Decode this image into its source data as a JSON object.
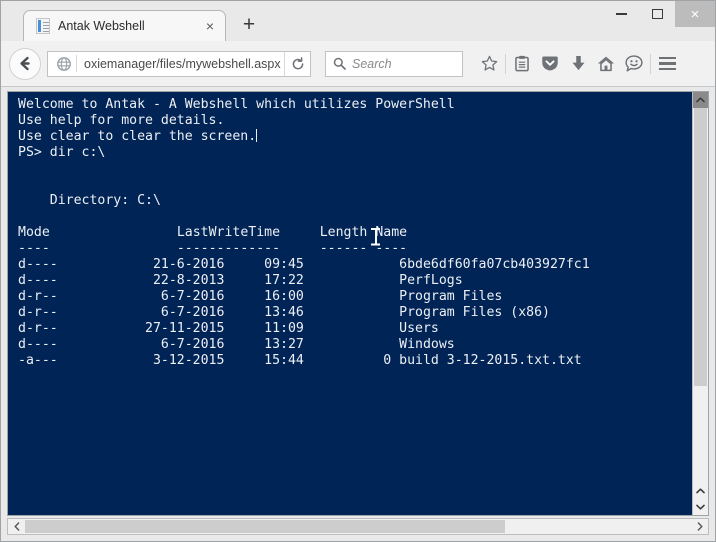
{
  "window": {
    "controls": {
      "minimize_label": "Minimize",
      "maximize_label": "Maximize",
      "close_label": "×"
    }
  },
  "tabs": [
    {
      "title": "Antak Webshell",
      "favicon": "document-icon",
      "close_label": "×",
      "active": true
    }
  ],
  "newtab": {
    "label": "+"
  },
  "navbar": {
    "back_label": "Back",
    "url_value": "oxiemanager/files/mywebshell.aspx",
    "reload_label": "Reload",
    "search_placeholder": "Search",
    "icons": [
      {
        "name": "bookmark-star-icon",
        "label": "Bookmark this page"
      },
      {
        "name": "reader-list-icon",
        "label": "Reading list"
      },
      {
        "name": "pocket-icon",
        "label": "Save to Pocket"
      },
      {
        "name": "downloads-icon",
        "label": "Downloads"
      },
      {
        "name": "home-icon",
        "label": "Home"
      },
      {
        "name": "feedback-smiley-icon",
        "label": "Feedback"
      },
      {
        "name": "menu-hamburger-icon",
        "label": "Open menu"
      }
    ]
  },
  "terminal": {
    "background_color": "#012456",
    "text_color": "#eceff4",
    "banner": [
      "Welcome to Antak - A Webshell which utilizes PowerShell",
      "Use help for more details.",
      "Use clear to clear the screen."
    ],
    "prompt": "PS>",
    "command": "dir c:\\",
    "directory_header": "    Directory: C:\\",
    "columns": {
      "mode": "Mode",
      "lastwritetime": "LastWriteTime",
      "length": "Length",
      "name": "Name",
      "mode_rule": "----",
      "lastwritetime_rule": "-------------",
      "length_rule": "------",
      "name_rule": "----"
    },
    "listing": [
      {
        "mode": "d----",
        "date": "21-6-2016",
        "time": "09:45",
        "length": "",
        "name": "6bde6df60fa07cb403927fc1"
      },
      {
        "mode": "d----",
        "date": "22-8-2013",
        "time": "17:22",
        "length": "",
        "name": "PerfLogs"
      },
      {
        "mode": "d-r--",
        "date": "6-7-2016",
        "time": "16:00",
        "length": "",
        "name": "Program Files"
      },
      {
        "mode": "d-r--",
        "date": "6-7-2016",
        "time": "13:46",
        "length": "",
        "name": "Program Files (x86)"
      },
      {
        "mode": "d-r--",
        "date": "27-11-2015",
        "time": "11:09",
        "length": "",
        "name": "Users"
      },
      {
        "mode": "d----",
        "date": "6-7-2016",
        "time": "13:27",
        "length": "",
        "name": "Windows"
      },
      {
        "mode": "-a---",
        "date": "3-12-2015",
        "time": "15:44",
        "length": "0",
        "name": "build 3-12-2015.txt.txt"
      }
    ],
    "rendered": "Welcome to Antak - A Webshell which utilizes PowerShell\nUse help for more details.\nUse clear to clear the screen."
  },
  "scrollbars": {
    "vertical": {
      "thumb_percent": 74,
      "up_label": "▲",
      "down_label": "▼"
    },
    "horizontal": {
      "thumb_percent": 72,
      "left_label": "‹",
      "right_label": "›"
    }
  }
}
